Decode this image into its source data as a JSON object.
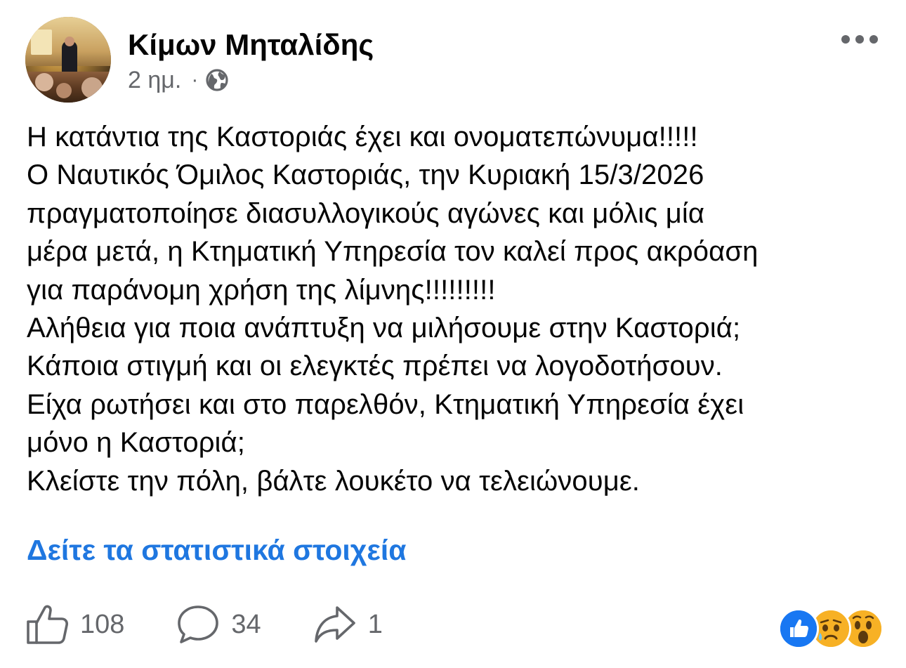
{
  "post": {
    "author": "Κίμων Μηταλίδης",
    "time": "2 ημ.",
    "separator": "·",
    "privacy_icon": "globe-icon",
    "more_icon": "more-options-icon",
    "lines": [
      "Η κατάντια της Καστοριάς έχει και ονοματεπώνυμα!!!!!",
      "Ο Ναυτικός Όμιλος Καστοριάς, την Κυριακή 15/3/2026",
      "πραγματοποίησε διασυλλογικούς αγώνες και μόλις μία",
      "μέρα μετά, η Κτηματική Υπηρεσία τον καλεί προς ακρόαση",
      "για παράνομη χρήση της λίμνης!!!!!!!!!",
      "Αλήθεια για ποια ανάπτυξη να μιλήσουμε στην Καστοριά;",
      "Κάποια στιγμή και οι ελεγκτές πρέπει να λογοδοτήσουν.",
      "Είχα ρωτήσει και στο παρελθόν, Κτηματική Υπηρεσία έχει",
      "μόνο η Καστοριά;",
      "Κλείστε την πόλη, βάλτε λουκέτο να τελειώνουμε."
    ],
    "insights_link": "Δείτε τα στατιστικά στοιχεία"
  },
  "actions": {
    "like": {
      "icon": "like-icon",
      "count": "108"
    },
    "comment": {
      "icon": "comment-icon",
      "count": "34"
    },
    "share": {
      "icon": "share-icon",
      "count": "1"
    }
  },
  "reactions": [
    "like-reaction-icon",
    "sad-reaction-icon",
    "wow-reaction-icon"
  ],
  "colors": {
    "link": "#1f77e0",
    "secondary_text": "#65676b",
    "text": "#050505",
    "like_blue": "#1877f2",
    "reaction_yellow": "#f7b125"
  }
}
